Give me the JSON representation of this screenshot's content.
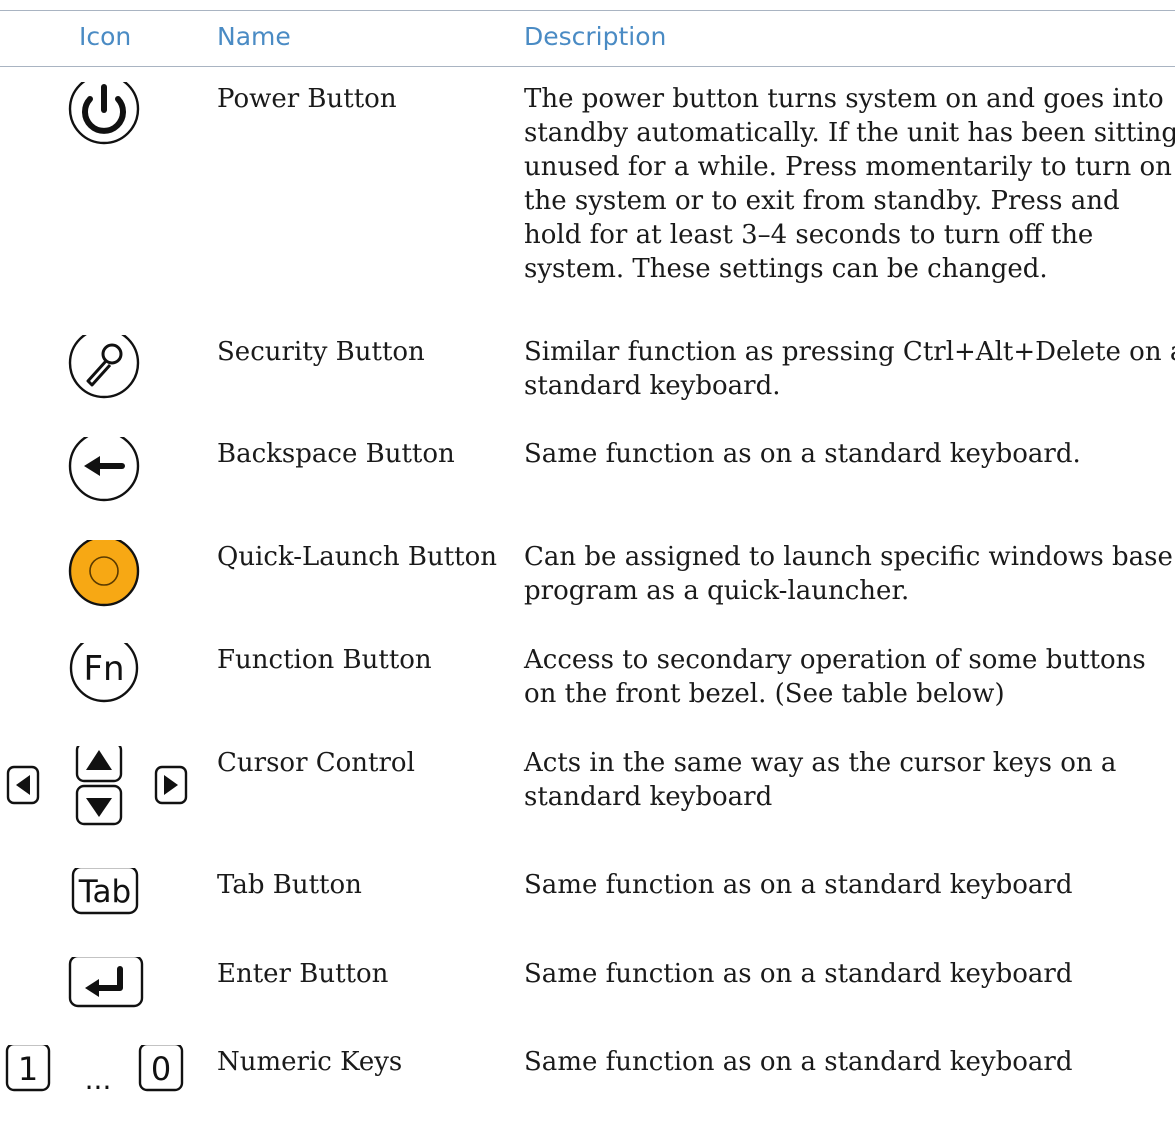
{
  "table": {
    "headers": {
      "icon": "Icon",
      "name": "Name",
      "description": "Description"
    },
    "rows": [
      {
        "icon": "power-icon",
        "name": "Power Button",
        "description": [
          "The power button turns system on and goes into",
          "standby automatically.  If the unit has been sitting",
          "unused for a while.  Press momentarily to turn on",
          "the system or to exit from standby.  Press and",
          "hold for at least 3–4 seconds to turn off the",
          "system.  These settings can be changed."
        ]
      },
      {
        "icon": "security-icon",
        "name": "Security Button",
        "description": [
          "Similar function as pressing Ctrl+Alt+Delete on a",
          "standard keyboard."
        ]
      },
      {
        "icon": "backspace-arrow-icon",
        "name": "Backspace Button",
        "description": [
          "Same function as on a standard keyboard."
        ]
      },
      {
        "icon": "quick-launch-icon",
        "name": "Quick-Launch Button",
        "description": [
          "Can be assigned to launch specific windows base",
          "program as a quick-launcher."
        ]
      },
      {
        "icon": "fn-icon",
        "icon_text": "Fn",
        "name": "Function Button",
        "description": [
          "Access to secondary operation of some buttons",
          "on the front bezel.  (See table below)"
        ]
      },
      {
        "icon": "cursor-keys-icon",
        "name": "Cursor Control",
        "description": [
          "Acts in the same way as the cursor keys on a",
          "standard keyboard"
        ]
      },
      {
        "icon": "tab-key-icon",
        "icon_text": "Tab",
        "name": "Tab Button",
        "description": [
          "Same function as on a standard keyboard"
        ]
      },
      {
        "icon": "enter-key-icon",
        "name": "Enter Button",
        "description": [
          "Same function as on a standard keyboard"
        ]
      },
      {
        "icon": "numeric-keys-icon",
        "icon_text": {
          "first": "1",
          "ellipsis": "...",
          "last": "0"
        },
        "name": "Numeric Keys",
        "description": [
          "Same function as on a standard keyboard"
        ]
      }
    ]
  },
  "colors": {
    "header": "#4a8bc4",
    "rule": "#a9b4c2",
    "quick_launch_fill": "#f7a814"
  }
}
